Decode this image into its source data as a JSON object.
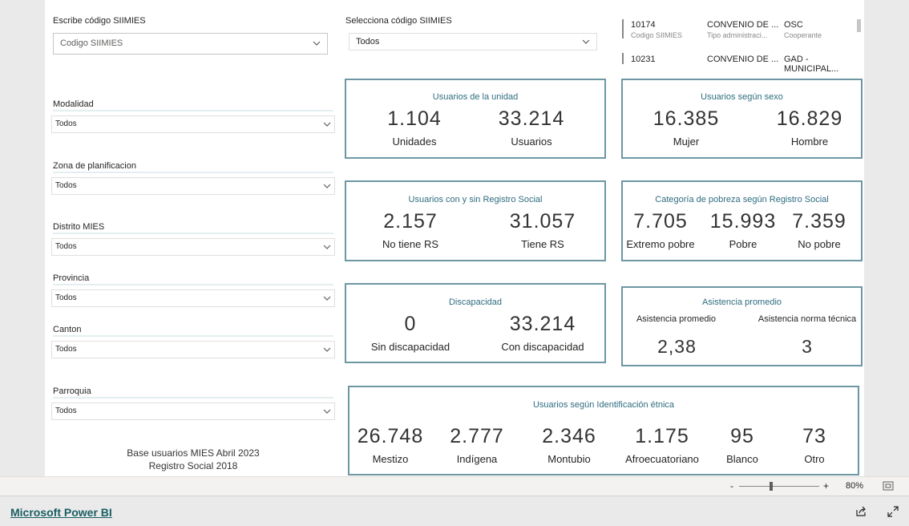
{
  "filters": {
    "escribe_label": "Escribe código SIIMIES",
    "escribe_placeholder": "Codigo SIIMIES",
    "selecciona_label": "Selecciona código SIIMIES",
    "selecciona_value": "Todos",
    "modalidad_label": "Modalidad",
    "modalidad_value": "Todos",
    "zona_label": "Zona de planificacion",
    "zona_value": "Todos",
    "distrito_label": "Distrito MIES",
    "distrito_value": "Todos",
    "provincia_label": "Provincia",
    "provincia_value": "Todos",
    "canton_label": "Canton",
    "canton_value": "Todos",
    "parroquia_label": "Parroquia",
    "parroquia_value": "Todos"
  },
  "table": {
    "rows": [
      {
        "code": "10174",
        "code_sub": "Codigo SIIMIES",
        "tipo": "CONVENIO DE ...",
        "tipo_sub": "Tipo administraci...",
        "osc": "OSC",
        "osc_sub": "Cooperante"
      },
      {
        "code": "10231",
        "tipo": "CONVENIO DE ...",
        "osc": "GAD - MUNICIPAL..."
      }
    ]
  },
  "cards": {
    "unidad": {
      "title": "Usuarios de la unidad",
      "v1": "1.104",
      "l1": "Unidades",
      "v2": "33.214",
      "l2": "Usuarios"
    },
    "sexo": {
      "title": "Usuarios según sexo",
      "v1": "16.385",
      "l1": "Mujer",
      "v2": "16.829",
      "l2": "Hombre"
    },
    "registro": {
      "title": "Usuarios con y sin Registro Social",
      "v1": "2.157",
      "l1": "No tiene RS",
      "v2": "31.057",
      "l2": "Tiene RS"
    },
    "pobreza": {
      "title": "Categoría de pobreza según Registro Social",
      "v1": "7.705",
      "l1": "Extremo pobre",
      "v2": "15.993",
      "l2": "Pobre",
      "v3": "7.359",
      "l3": "No pobre"
    },
    "discapacidad": {
      "title": "Discapacidad",
      "v1": "0",
      "l1": "Sin discapacidad",
      "v2": "33.214",
      "l2": "Con discapacidad"
    },
    "asistencia": {
      "title": "Asistencia promedio",
      "l1": "Asistencia promedio",
      "v1": "2,38",
      "l2": "Asistencia norma técnica",
      "v2": "3"
    },
    "etnica": {
      "title": "Usuarios según Identificación étnica",
      "items": [
        {
          "v": "26.748",
          "l": "Mestizo"
        },
        {
          "v": "2.777",
          "l": "Indígena"
        },
        {
          "v": "2.346",
          "l": "Montubio"
        },
        {
          "v": "1.175",
          "l": "Afroecuatoriano"
        },
        {
          "v": "95",
          "l": "Blanco"
        },
        {
          "v": "73",
          "l": "Otro"
        }
      ]
    }
  },
  "footnote": {
    "line1": "Base usuarios MIES  Abril 2023",
    "line2": "Registro Social 2018"
  },
  "zoom": {
    "minus": "-",
    "plus": "+",
    "level": "80%",
    "level_fraction": 0.4
  },
  "bottom": {
    "link": "Microsoft Power BI"
  },
  "icons": {
    "share": "share-icon",
    "fullscreen": "fullscreen-icon",
    "fit": "fit-page-icon",
    "chevron": "chevron-down-icon"
  },
  "colors": {
    "card_border": "#6d97a3",
    "card_title": "#2f6d80",
    "link": "#1a5e63"
  }
}
